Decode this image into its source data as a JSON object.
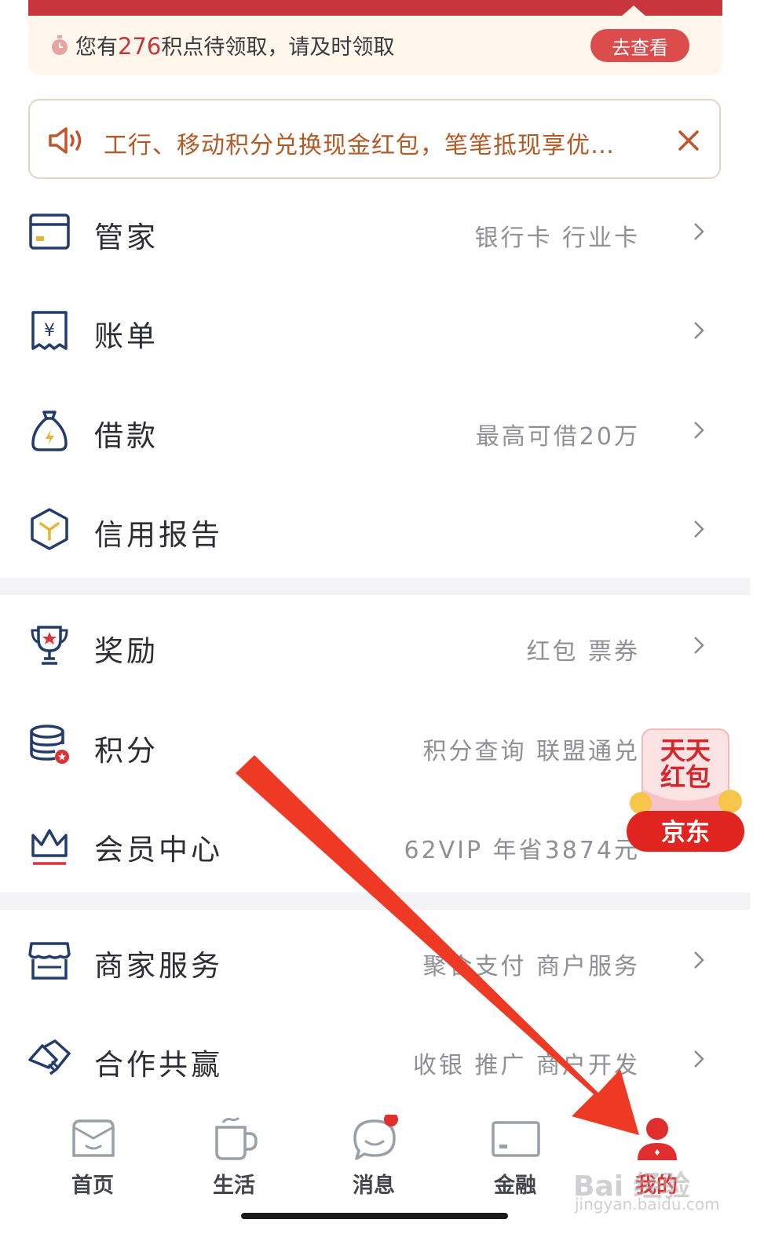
{
  "points_banner": {
    "prefix": "您有",
    "count": "276",
    "suffix": "积点待领取，请及时领取",
    "button_label": "去查看"
  },
  "notice": {
    "text": "工行、移动积分兑换现金红包，笔笔抵现享优…"
  },
  "menu_group_1": [
    {
      "label": "管家",
      "sub": "银行卡 行业卡"
    },
    {
      "label": "账单",
      "sub": ""
    },
    {
      "label": "借款",
      "sub": "最高可借20万"
    },
    {
      "label": "信用报告",
      "sub": ""
    }
  ],
  "menu_group_2": [
    {
      "label": "奖励",
      "sub": "红包 票券"
    },
    {
      "label": "积分",
      "sub": "积分查询 联盟通兑"
    },
    {
      "label": "会员中心",
      "sub": "62VIP 年省3874元"
    }
  ],
  "menu_group_3": [
    {
      "label": "商家服务",
      "sub": "聚合支付 商户服务"
    },
    {
      "label": "合作共赢",
      "sub": "收银 推广 商户开发"
    }
  ],
  "promo": {
    "line1": "天天",
    "line2": "红包",
    "brand": "京东"
  },
  "tabbar": [
    {
      "label": "首页",
      "icon": "home-icon"
    },
    {
      "label": "生活",
      "icon": "cup-icon"
    },
    {
      "label": "消息",
      "icon": "chat-icon"
    },
    {
      "label": "金融",
      "icon": "card-icon"
    },
    {
      "label": "我的",
      "icon": "user-icon"
    }
  ],
  "watermark": {
    "main": "Bai 经验",
    "sub": "jingyan.baidu.com"
  },
  "colors": {
    "brand_red": "#c8353c",
    "notice_text": "#b15a26",
    "icon_navy": "#233c6b",
    "arrow": "#ee3a24"
  }
}
